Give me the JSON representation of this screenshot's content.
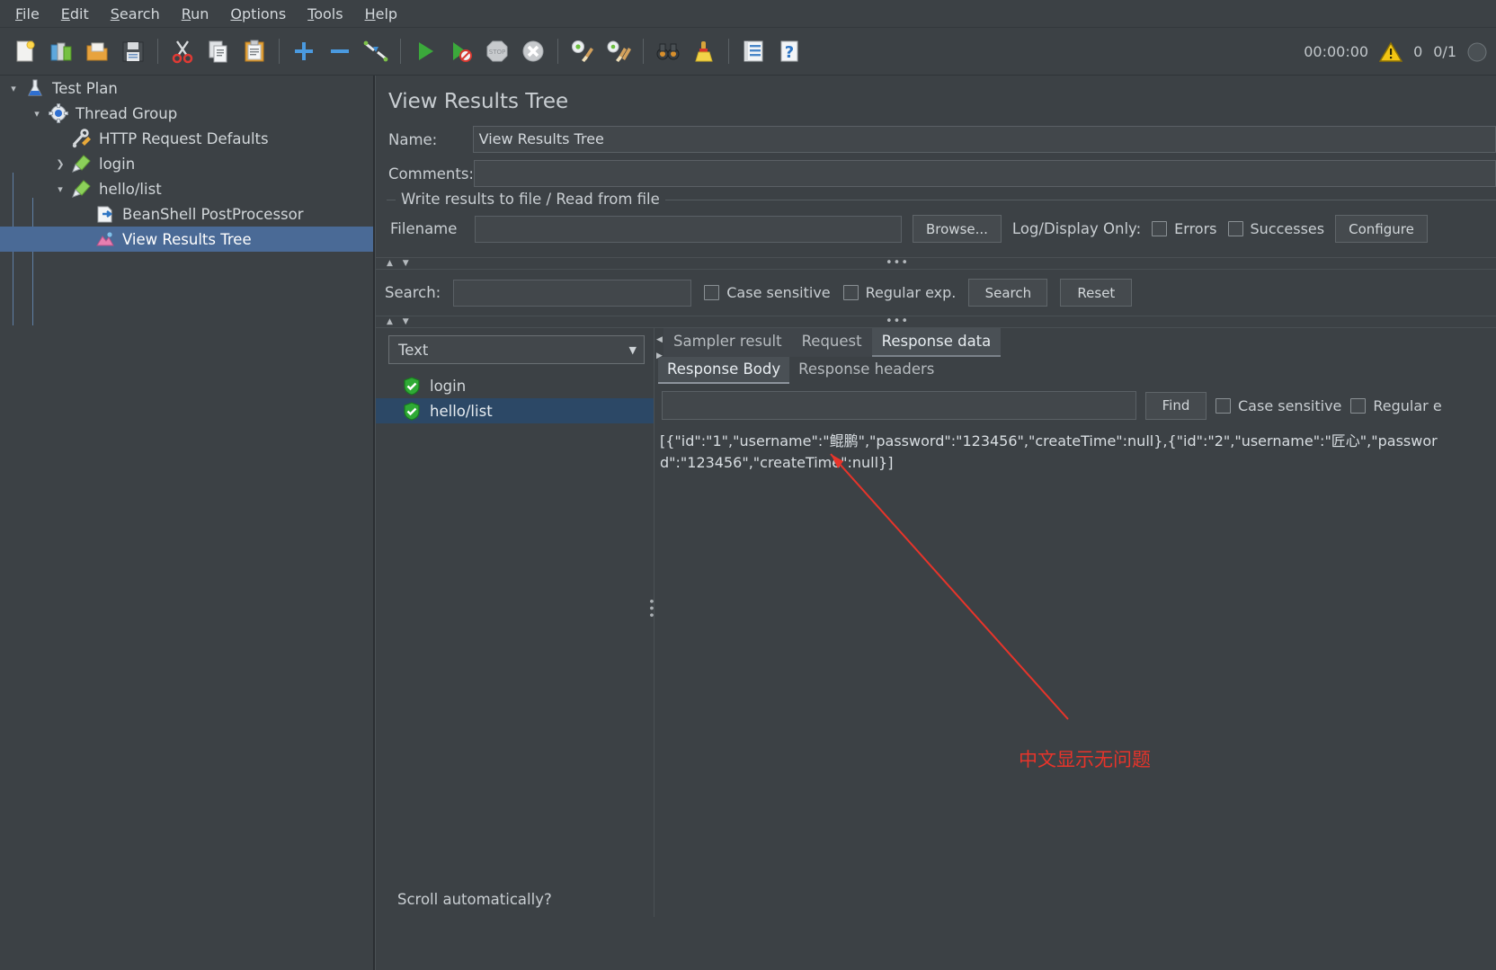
{
  "menu": {
    "items": [
      {
        "label": "File",
        "accel": "F"
      },
      {
        "label": "Edit",
        "accel": "E"
      },
      {
        "label": "Search",
        "accel": "S"
      },
      {
        "label": "Run",
        "accel": "R"
      },
      {
        "label": "Options",
        "accel": "O"
      },
      {
        "label": "Tools",
        "accel": "T"
      },
      {
        "label": "Help",
        "accel": "H"
      }
    ]
  },
  "toolbar": {
    "buttons": [
      {
        "name": "new-icon"
      },
      {
        "name": "templates-icon"
      },
      {
        "name": "open-icon"
      },
      {
        "name": "save-icon"
      },
      {
        "name": "cut-icon"
      },
      {
        "name": "copy-icon"
      },
      {
        "name": "paste-icon"
      },
      {
        "name": "expand-all-icon"
      },
      {
        "name": "collapse-all-icon"
      },
      {
        "name": "toggle-icon"
      },
      {
        "name": "start-icon"
      },
      {
        "name": "start-no-pauses-icon"
      },
      {
        "name": "stop-icon"
      },
      {
        "name": "shutdown-icon"
      },
      {
        "name": "clear-icon"
      },
      {
        "name": "clear-all-icon"
      },
      {
        "name": "search-icon"
      },
      {
        "name": "search-reset-icon"
      },
      {
        "name": "function-helper-icon"
      },
      {
        "name": "help-icon"
      }
    ],
    "timer": "00:00:00",
    "warning_count": "0",
    "threads": "0/1"
  },
  "tree": {
    "nodes": [
      {
        "label": "Test Plan",
        "icon": "test-plan-icon",
        "indent": 1,
        "twisty": "down",
        "selected": false
      },
      {
        "label": "Thread Group",
        "icon": "thread-group-icon",
        "indent": 2,
        "twisty": "down",
        "selected": false
      },
      {
        "label": "HTTP Request Defaults",
        "icon": "config-icon",
        "indent": 3,
        "twisty": "none",
        "selected": false
      },
      {
        "label": "login",
        "icon": "sampler-icon",
        "indent": 3,
        "twisty": "right",
        "selected": false
      },
      {
        "label": "hello/list",
        "icon": "sampler-icon",
        "indent": 3,
        "twisty": "down",
        "selected": false
      },
      {
        "label": "BeanShell PostProcessor",
        "icon": "postprocessor-icon",
        "indent": 4,
        "twisty": "none",
        "selected": false
      },
      {
        "label": "View Results Tree",
        "icon": "listener-icon",
        "indent": 4,
        "twisty": "none",
        "selected": true
      }
    ]
  },
  "panel": {
    "title": "View Results Tree",
    "name_label": "Name:",
    "name_value": "View Results Tree",
    "comments_label": "Comments:",
    "comments_value": "",
    "file_group_title": "Write results to file / Read from file",
    "filename_label": "Filename",
    "filename_value": "",
    "browse_button": "Browse...",
    "log_display_label": "Log/Display Only:",
    "errors_checkbox": "Errors",
    "successes_checkbox": "Successes",
    "configure_button": "Configure"
  },
  "search_bar": {
    "label": "Search:",
    "value": "",
    "case_sensitive": "Case sensitive",
    "regular_exp": "Regular exp.",
    "search_button": "Search",
    "reset_button": "Reset"
  },
  "results": {
    "renderer_selected": "Text",
    "items": [
      {
        "label": "login",
        "status": "success",
        "selected": false
      },
      {
        "label": "hello/list",
        "status": "success",
        "selected": true
      }
    ],
    "scroll_automatically": "Scroll automatically?"
  },
  "viewer": {
    "tabs": [
      {
        "label": "Sampler result",
        "active": false
      },
      {
        "label": "Request",
        "active": false
      },
      {
        "label": "Response data",
        "active": true
      }
    ],
    "subtabs": [
      {
        "label": "Response Body",
        "active": true
      },
      {
        "label": "Response headers",
        "active": false
      }
    ],
    "find_value": "",
    "find_button": "Find",
    "case_sensitive": "Case sensitive",
    "regular_exp": "Regular e",
    "response_body": "[{\"id\":\"1\",\"username\":\"鲲鹏\",\"password\":\"123456\",\"createTime\":null},{\"id\":\"2\",\"username\":\"匠心\",\"password\":\"123456\",\"createTime\":null}]"
  },
  "annotation": {
    "text": "中文显示无问题",
    "color": "#e8342a"
  }
}
